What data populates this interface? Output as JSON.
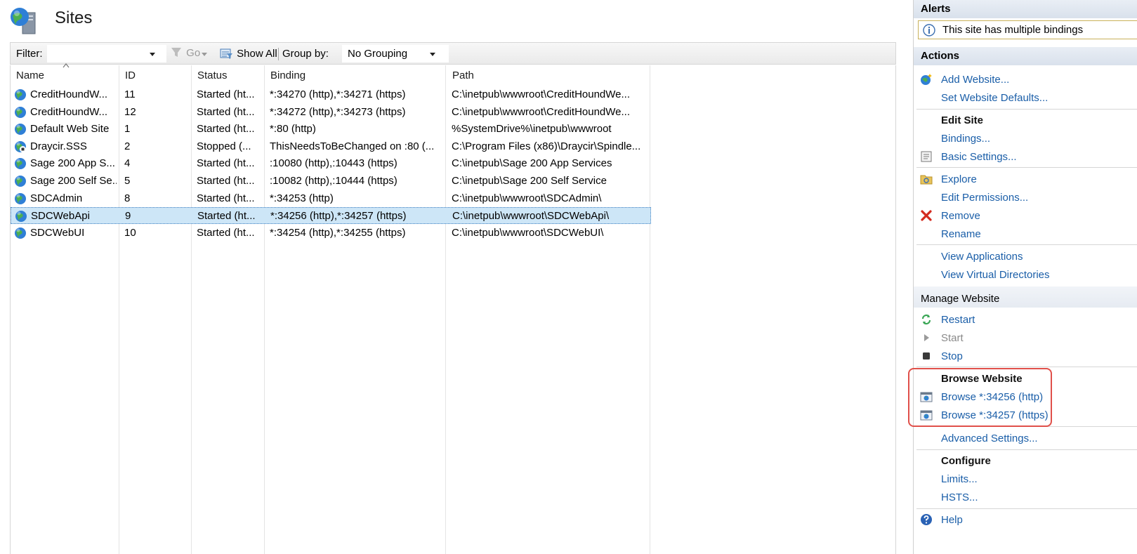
{
  "header": {
    "title": "Sites"
  },
  "filterbar": {
    "filter_label": "Filter:",
    "filter_value": "",
    "go_label": "Go",
    "show_all_label": "Show All",
    "group_by_label": "Group by:",
    "group_by_value": "No Grouping"
  },
  "table": {
    "columns": [
      "Name",
      "ID",
      "Status",
      "Binding",
      "Path"
    ],
    "rows": [
      {
        "name": "CreditHoundW...",
        "id": "11",
        "status": "Started (ht...",
        "binding": "*:34270 (http),*:34271 (https)",
        "path": "C:\\inetpub\\wwwroot\\CreditHoundWe...",
        "icon": "globe-icon"
      },
      {
        "name": "CreditHoundW...",
        "id": "12",
        "status": "Started (ht...",
        "binding": "*:34272 (http),*:34273 (https)",
        "path": "C:\\inetpub\\wwwroot\\CreditHoundWe...",
        "icon": "globe-icon"
      },
      {
        "name": "Default Web Site",
        "id": "1",
        "status": "Started (ht...",
        "binding": "*:80 (http)",
        "path": "%SystemDrive%\\inetpub\\wwwroot",
        "icon": "globe-icon"
      },
      {
        "name": "Draycir.SSS",
        "id": "2",
        "status": "Stopped (...",
        "binding": "ThisNeedsToBeChanged on :80 (...",
        "path": "C:\\Program Files (x86)\\Draycir\\Spindle...",
        "icon": "globe-stopped-icon"
      },
      {
        "name": "Sage 200 App S...",
        "id": "4",
        "status": "Started (ht...",
        "binding": ":10080 (http),:10443 (https)",
        "path": "C:\\inetpub\\Sage 200 App Services",
        "icon": "globe-icon"
      },
      {
        "name": "Sage 200 Self Se...",
        "id": "5",
        "status": "Started (ht...",
        "binding": ":10082 (http),:10444 (https)",
        "path": "C:\\inetpub\\Sage 200 Self Service",
        "icon": "globe-icon"
      },
      {
        "name": "SDCAdmin",
        "id": "8",
        "status": "Started (ht...",
        "binding": "*:34253 (http)",
        "path": "C:\\inetpub\\wwwroot\\SDCAdmin\\",
        "icon": "globe-icon"
      },
      {
        "name": "SDCWebApi",
        "id": "9",
        "status": "Started (ht...",
        "binding": "*:34256 (http),*:34257 (https)",
        "path": "C:\\inetpub\\wwwroot\\SDCWebApi\\",
        "icon": "globe-icon",
        "selected": true
      },
      {
        "name": "SDCWebUI",
        "id": "10",
        "status": "Started (ht...",
        "binding": "*:34254 (http),*:34255 (https)",
        "path": "C:\\inetpub\\wwwroot\\SDCWebUI\\",
        "icon": "globe-icon"
      }
    ]
  },
  "pane": {
    "alerts_header": "Alerts",
    "alert_text": "This site has multiple bindings",
    "actions_header": "Actions",
    "add_website": "Add Website...",
    "set_defaults": "Set Website Defaults...",
    "edit_site": "Edit Site",
    "bindings": "Bindings...",
    "basic_settings": "Basic Settings...",
    "explore": "Explore",
    "edit_permissions": "Edit Permissions...",
    "remove": "Remove",
    "rename": "Rename",
    "view_applications": "View Applications",
    "view_virtual_dirs": "View Virtual Directories",
    "manage_website": "Manage Website",
    "restart": "Restart",
    "start": "Start",
    "stop": "Stop",
    "browse_website": "Browse Website",
    "browse_http": "Browse *:34256 (http)",
    "browse_https": "Browse *:34257 (https)",
    "advanced_settings": "Advanced Settings...",
    "configure": "Configure",
    "limits": "Limits...",
    "hsts": "HSTS...",
    "help": "Help"
  },
  "colors": {
    "link": "#1a5ea8",
    "selection": "#cde6f7",
    "highlight": "#e0504a"
  }
}
